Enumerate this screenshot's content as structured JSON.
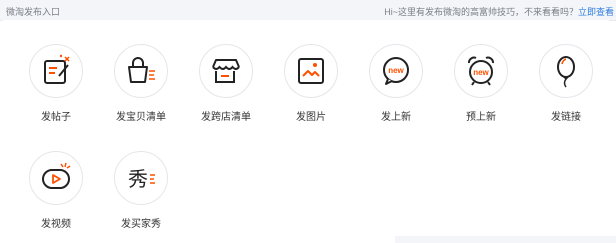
{
  "header": {
    "title": "微淘发布入口",
    "tip_text": "Hi~这里有发布微淘的高富帅技巧，不来看看吗？",
    "tip_link": "立即查看"
  },
  "items": [
    {
      "label": "发帖子",
      "icon": "post-icon"
    },
    {
      "label": "发宝贝清单",
      "icon": "shopping-bag-list-icon"
    },
    {
      "label": "发跨店清单",
      "icon": "store-list-icon"
    },
    {
      "label": "发图片",
      "icon": "image-icon"
    },
    {
      "label": "发上新",
      "icon": "new-bubble-icon"
    },
    {
      "label": "预上新",
      "icon": "alarm-new-icon"
    },
    {
      "label": "发链接",
      "icon": "balloon-link-icon"
    },
    {
      "label": "发视频",
      "icon": "video-icon"
    },
    {
      "label": "发买家秀",
      "icon": "buyer-show-icon"
    }
  ],
  "colors": {
    "icon_stroke": "#222222",
    "accent": "#ff5000",
    "link": "#2f7de1",
    "circle_border": "#e4e6ea"
  },
  "icon_text": {
    "new": "new",
    "show": "秀"
  }
}
